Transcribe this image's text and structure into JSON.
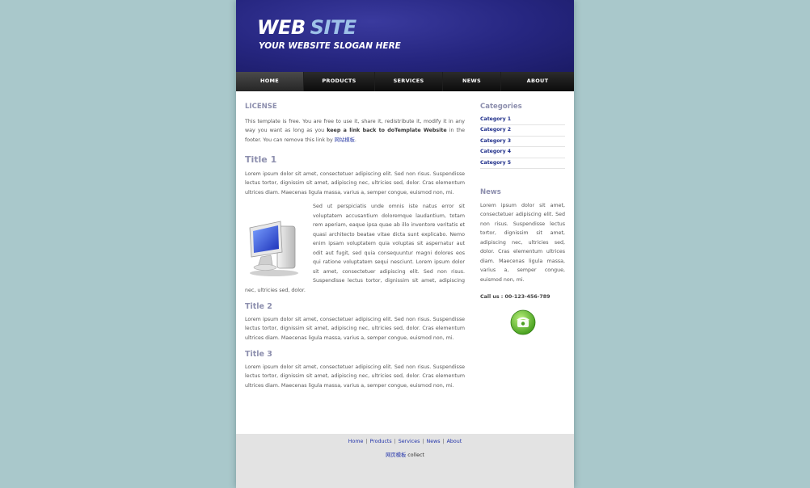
{
  "header": {
    "logo_part1": "WEB",
    "logo_part2": "SITE",
    "slogan": "YOUR WEBSITE SLOGAN HERE"
  },
  "nav": {
    "items": [
      "HOME",
      "PRODUCTS",
      "SERVICES",
      "NEWS",
      "ABOUT"
    ],
    "active": "HOME"
  },
  "main": {
    "license": {
      "title": "LICENSE",
      "text1": "This template is free. You are free to use it, share it, redistribute it, modify it in any way you want as long as you ",
      "bold": "keep a link back to doTemplate Website",
      "text2": " in the footer. You can remove this link by ",
      "link": "网站模板",
      "text3": "."
    },
    "section1": {
      "title": "Title 1",
      "para1": "Lorem ipsum dolor sit amet, consectetuer adipiscing elit. Sed non risus. Suspendisse lectus tortor, dignissim sit amet, adipiscing nec, ultricies sed, dolor. Cras elementum ultrices diam. Maecenas ligula massa, varius a, semper congue, euismod non, mi.",
      "para2": "Sed ut perspiciatis unde omnis iste natus error sit voluptatem accusantium doloremque laudantium, totam rem aperiam, eaque ipsa quae ab illo inventore veritatis et quasi architecto beatae vitae dicta sunt explicabo. Nemo enim ipsam voluptatem quia voluptas sit aspernatur aut odit aut fugit, sed quia consequuntur magni dolores eos qui ratione voluptatem sequi nesciunt. Lorem ipsum dolor sit amet, consectetuer adipiscing elit. Sed non risus. Suspendisse lectus tortor, dignissim sit amet, adipiscing nec, ultricies sed, dolor."
    },
    "section2": {
      "title": "Title 2",
      "para": "Lorem ipsum dolor sit amet, consectetuer adipiscing elit. Sed non risus. Suspendisse lectus tortor, dignissim sit amet, adipiscing nec, ultricies sed, dolor. Cras elementum ultrices diam. Maecenas ligula massa, varius a, semper congue, euismod non, mi."
    },
    "section3": {
      "title": "Title 3",
      "para": "Lorem ipsum dolor sit amet, consectetuer adipiscing elit. Sed non risus. Suspendisse lectus tortor, dignissim sit amet, adipiscing nec, ultricies sed, dolor. Cras elementum ultrices diam. Maecenas ligula massa, varius a, semper congue, euismod non, mi."
    }
  },
  "sidebar": {
    "categories_title": "Categories",
    "categories": [
      "Category 1",
      "Category 2",
      "Category 3",
      "Category 4",
      "Category 5"
    ],
    "news_title": "News",
    "news_text": "Lorem ipsum dolor sit amet, consectetuer adipiscing elit. Sed non risus. Suspendisse lectus tortor, dignissim sit amet, adipiscing nec, ultricies sed, dolor. Cras elementum ultrices diam. Maecenas ligula massa, varius a, semper congue, euismod non, mi.",
    "call": "Call us : 00-123-456-789"
  },
  "footer": {
    "links": [
      "Home",
      "Products",
      "Services",
      "News",
      "About"
    ],
    "separator": "|",
    "collect_link": "网页模板",
    "collect_text": " collect"
  },
  "colors": {
    "background": "#a9c8cb",
    "header_blue": "#262680",
    "heading": "#8d8fae",
    "link": "#1f2f8a"
  }
}
